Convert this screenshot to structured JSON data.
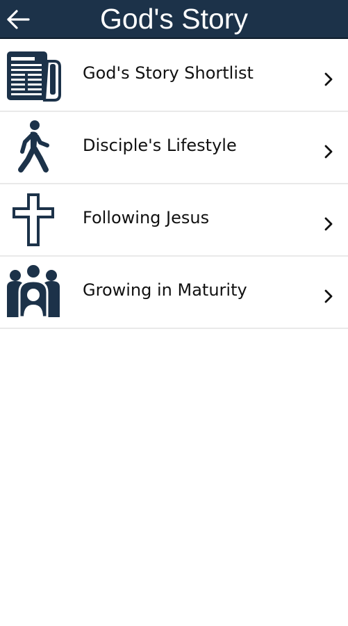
{
  "header": {
    "title": "God's Story",
    "back_icon": "arrow-left-icon"
  },
  "colors": {
    "header_bg": "#1c3249",
    "icon": "#1c3249",
    "text": "#111111",
    "divider": "#e9e9e9"
  },
  "menu": {
    "items": [
      {
        "label": "God's Story Shortlist",
        "icon": "newspaper-icon",
        "trailing_icon": "chevron-right-icon"
      },
      {
        "label": "Disciple's Lifestyle",
        "icon": "walking-person-icon",
        "trailing_icon": "chevron-right-icon"
      },
      {
        "label": "Following Jesus",
        "icon": "cross-icon",
        "trailing_icon": "chevron-right-icon"
      },
      {
        "label": "Growing in Maturity",
        "icon": "group-people-icon",
        "trailing_icon": "chevron-right-icon"
      }
    ]
  }
}
